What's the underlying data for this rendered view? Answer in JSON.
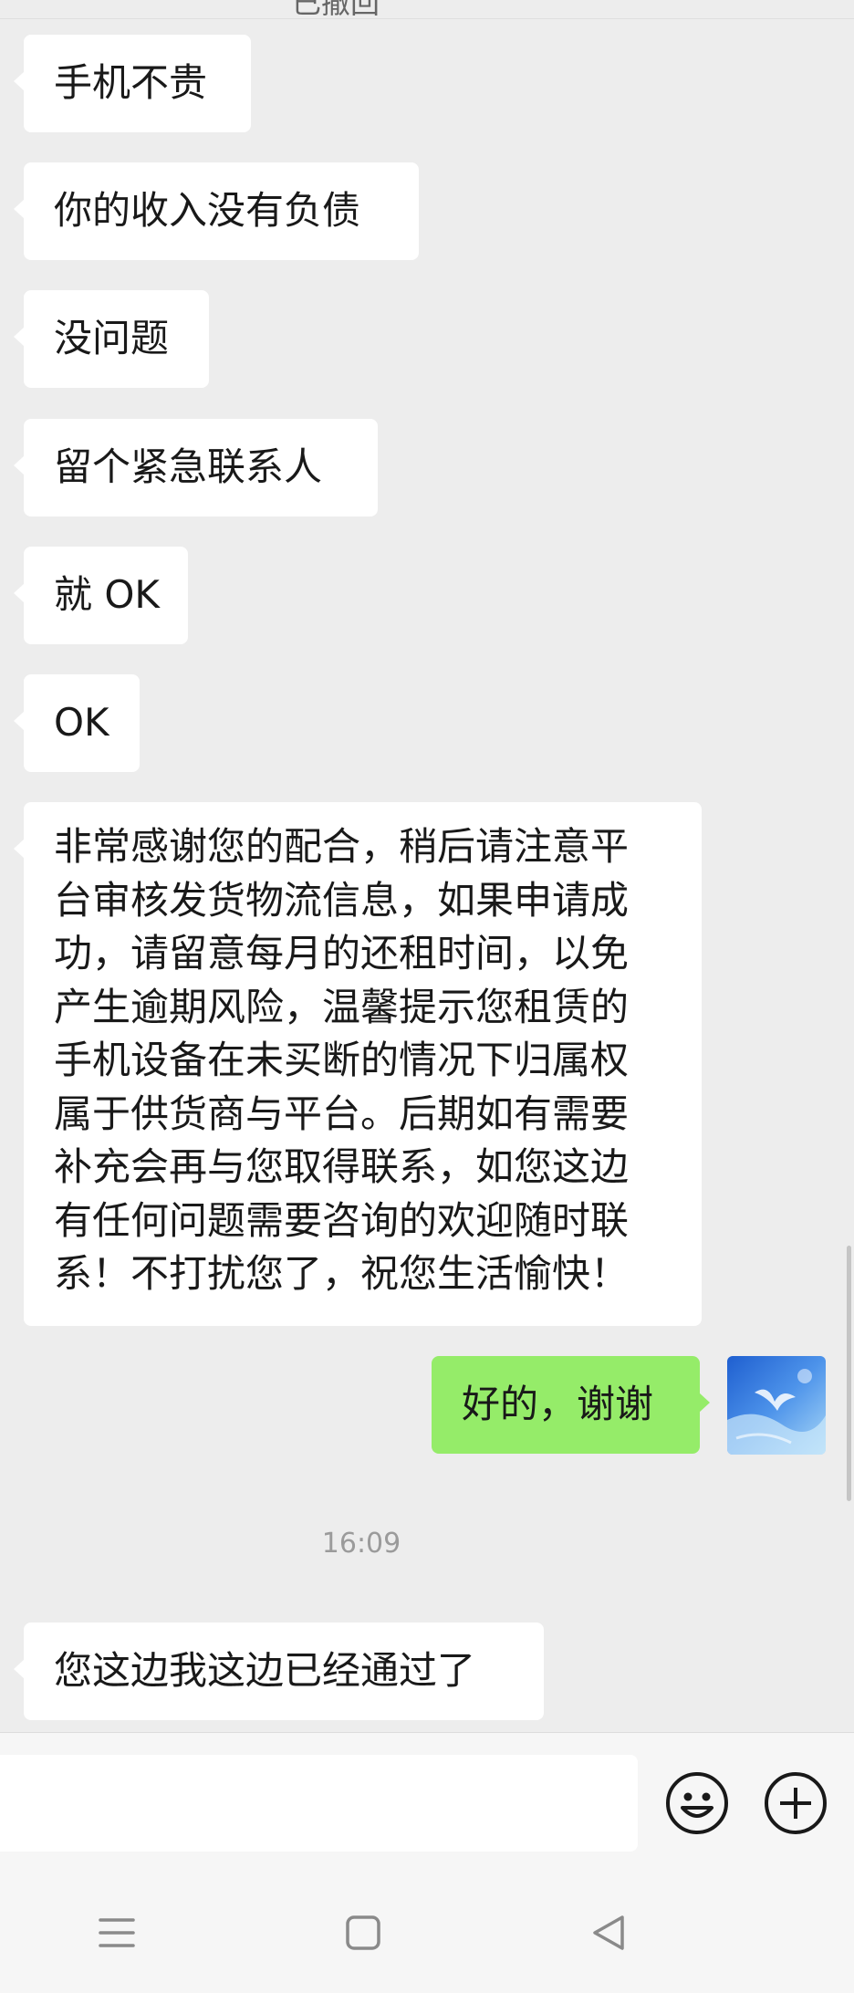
{
  "header": {
    "clipped_title": "已撤回"
  },
  "messages": [
    {
      "side": "left",
      "text": "手机不贵"
    },
    {
      "side": "left",
      "text": "你的收入没有负债"
    },
    {
      "side": "left",
      "text": "没问题"
    },
    {
      "side": "left",
      "text": "留个紧急联系人"
    },
    {
      "side": "left",
      "text": "就 OK"
    },
    {
      "side": "left",
      "text": "OK"
    },
    {
      "side": "left",
      "lines": [
        "非常感谢您的配合，稍后请注意平",
        "台审核发货物流信息，如果申请成",
        "功，请留意每月的还租时间，以免",
        "产生逾期风险，温馨提示您租赁的",
        "手机设备在未买断的情况下归属权",
        "属于供货商与平台。后期如有需要",
        "补充会再与您取得联系，如您这边",
        "有任何问题需要咨询的欢迎随时联",
        "系！不打扰您了，祝您生活愉快！"
      ]
    },
    {
      "side": "right",
      "text": "好的，谢谢"
    },
    {
      "side": "left",
      "text": "您这边我这边已经通过了"
    }
  ],
  "timestamp": "16:09",
  "input_bar": {
    "value": "",
    "emoji_icon": "emoji-icon",
    "plus_icon": "plus-icon"
  },
  "nav_bar": {
    "menu_icon": "menu-icon",
    "home_icon": "home-icon",
    "back_icon": "back-icon"
  },
  "colors": {
    "background": "#ededed",
    "bubble_in": "#ffffff",
    "bubble_out": "#95ec69",
    "text": "#191919"
  }
}
